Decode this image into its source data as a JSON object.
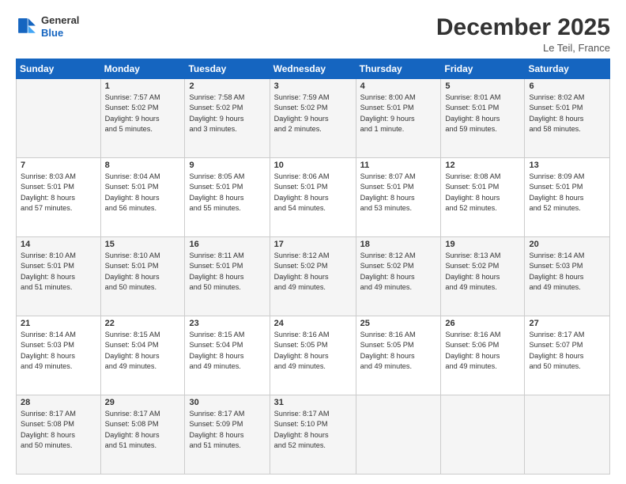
{
  "header": {
    "logo_line1": "General",
    "logo_line2": "Blue",
    "month": "December 2025",
    "location": "Le Teil, France"
  },
  "weekdays": [
    "Sunday",
    "Monday",
    "Tuesday",
    "Wednesday",
    "Thursday",
    "Friday",
    "Saturday"
  ],
  "weeks": [
    [
      {
        "day": "",
        "info": ""
      },
      {
        "day": "1",
        "info": "Sunrise: 7:57 AM\nSunset: 5:02 PM\nDaylight: 9 hours\nand 5 minutes."
      },
      {
        "day": "2",
        "info": "Sunrise: 7:58 AM\nSunset: 5:02 PM\nDaylight: 9 hours\nand 3 minutes."
      },
      {
        "day": "3",
        "info": "Sunrise: 7:59 AM\nSunset: 5:02 PM\nDaylight: 9 hours\nand 2 minutes."
      },
      {
        "day": "4",
        "info": "Sunrise: 8:00 AM\nSunset: 5:01 PM\nDaylight: 9 hours\nand 1 minute."
      },
      {
        "day": "5",
        "info": "Sunrise: 8:01 AM\nSunset: 5:01 PM\nDaylight: 8 hours\nand 59 minutes."
      },
      {
        "day": "6",
        "info": "Sunrise: 8:02 AM\nSunset: 5:01 PM\nDaylight: 8 hours\nand 58 minutes."
      }
    ],
    [
      {
        "day": "7",
        "info": "Sunrise: 8:03 AM\nSunset: 5:01 PM\nDaylight: 8 hours\nand 57 minutes."
      },
      {
        "day": "8",
        "info": "Sunrise: 8:04 AM\nSunset: 5:01 PM\nDaylight: 8 hours\nand 56 minutes."
      },
      {
        "day": "9",
        "info": "Sunrise: 8:05 AM\nSunset: 5:01 PM\nDaylight: 8 hours\nand 55 minutes."
      },
      {
        "day": "10",
        "info": "Sunrise: 8:06 AM\nSunset: 5:01 PM\nDaylight: 8 hours\nand 54 minutes."
      },
      {
        "day": "11",
        "info": "Sunrise: 8:07 AM\nSunset: 5:01 PM\nDaylight: 8 hours\nand 53 minutes."
      },
      {
        "day": "12",
        "info": "Sunrise: 8:08 AM\nSunset: 5:01 PM\nDaylight: 8 hours\nand 52 minutes."
      },
      {
        "day": "13",
        "info": "Sunrise: 8:09 AM\nSunset: 5:01 PM\nDaylight: 8 hours\nand 52 minutes."
      }
    ],
    [
      {
        "day": "14",
        "info": "Sunrise: 8:10 AM\nSunset: 5:01 PM\nDaylight: 8 hours\nand 51 minutes."
      },
      {
        "day": "15",
        "info": "Sunrise: 8:10 AM\nSunset: 5:01 PM\nDaylight: 8 hours\nand 50 minutes."
      },
      {
        "day": "16",
        "info": "Sunrise: 8:11 AM\nSunset: 5:01 PM\nDaylight: 8 hours\nand 50 minutes."
      },
      {
        "day": "17",
        "info": "Sunrise: 8:12 AM\nSunset: 5:02 PM\nDaylight: 8 hours\nand 49 minutes."
      },
      {
        "day": "18",
        "info": "Sunrise: 8:12 AM\nSunset: 5:02 PM\nDaylight: 8 hours\nand 49 minutes."
      },
      {
        "day": "19",
        "info": "Sunrise: 8:13 AM\nSunset: 5:02 PM\nDaylight: 8 hours\nand 49 minutes."
      },
      {
        "day": "20",
        "info": "Sunrise: 8:14 AM\nSunset: 5:03 PM\nDaylight: 8 hours\nand 49 minutes."
      }
    ],
    [
      {
        "day": "21",
        "info": "Sunrise: 8:14 AM\nSunset: 5:03 PM\nDaylight: 8 hours\nand 49 minutes."
      },
      {
        "day": "22",
        "info": "Sunrise: 8:15 AM\nSunset: 5:04 PM\nDaylight: 8 hours\nand 49 minutes."
      },
      {
        "day": "23",
        "info": "Sunrise: 8:15 AM\nSunset: 5:04 PM\nDaylight: 8 hours\nand 49 minutes."
      },
      {
        "day": "24",
        "info": "Sunrise: 8:16 AM\nSunset: 5:05 PM\nDaylight: 8 hours\nand 49 minutes."
      },
      {
        "day": "25",
        "info": "Sunrise: 8:16 AM\nSunset: 5:05 PM\nDaylight: 8 hours\nand 49 minutes."
      },
      {
        "day": "26",
        "info": "Sunrise: 8:16 AM\nSunset: 5:06 PM\nDaylight: 8 hours\nand 49 minutes."
      },
      {
        "day": "27",
        "info": "Sunrise: 8:17 AM\nSunset: 5:07 PM\nDaylight: 8 hours\nand 50 minutes."
      }
    ],
    [
      {
        "day": "28",
        "info": "Sunrise: 8:17 AM\nSunset: 5:08 PM\nDaylight: 8 hours\nand 50 minutes."
      },
      {
        "day": "29",
        "info": "Sunrise: 8:17 AM\nSunset: 5:08 PM\nDaylight: 8 hours\nand 51 minutes."
      },
      {
        "day": "30",
        "info": "Sunrise: 8:17 AM\nSunset: 5:09 PM\nDaylight: 8 hours\nand 51 minutes."
      },
      {
        "day": "31",
        "info": "Sunrise: 8:17 AM\nSunset: 5:10 PM\nDaylight: 8 hours\nand 52 minutes."
      },
      {
        "day": "",
        "info": ""
      },
      {
        "day": "",
        "info": ""
      },
      {
        "day": "",
        "info": ""
      }
    ]
  ]
}
